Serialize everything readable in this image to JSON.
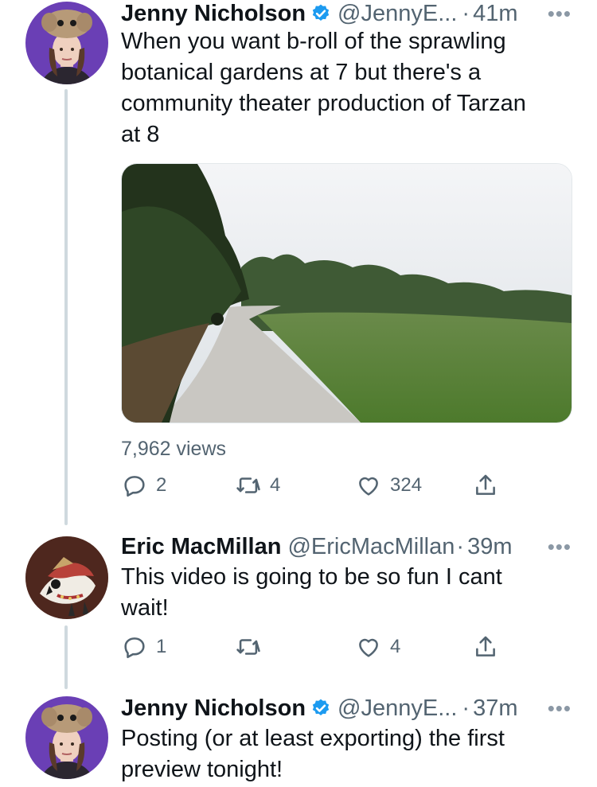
{
  "tweets": [
    {
      "name": "Jenny Nicholson",
      "handle": "@JennyE...",
      "dot": "·",
      "time": "41m",
      "text_lines": [
        "When you want b-roll of the sprawling",
        "botanical gardens at 7 but there's a",
        "community theater production of Tarzan",
        "at 8"
      ],
      "views": "7,962 views",
      "replies": "2",
      "retweets": "4",
      "likes": "324"
    },
    {
      "name": "Eric MacMillan",
      "handle": "@EricMacMillan",
      "dot": "·",
      "time": "39m",
      "text_lines": [
        "This video is going to be so fun I cant",
        "wait!"
      ],
      "replies": "1",
      "retweets": "",
      "likes": "4"
    },
    {
      "name": "Jenny Nicholson",
      "handle": "@JennyE...",
      "dot": "·",
      "time": "37m",
      "text_lines": [
        "Posting (or at least exporting) the first",
        "preview tonight!"
      ]
    }
  ],
  "more_glyph": "•••",
  "colors": {
    "verified": "#1d9bf0",
    "secondary_text": "#536471",
    "thread_line": "#cfd9de",
    "avatar_bg": "#6a3fb5"
  },
  "icons": [
    "verified-badge-icon",
    "more-icon",
    "reply-icon",
    "retweet-icon",
    "like-icon",
    "share-icon"
  ]
}
